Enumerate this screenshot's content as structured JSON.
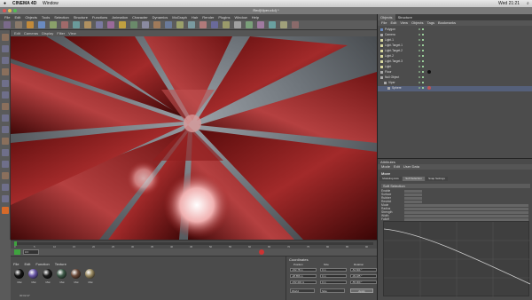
{
  "os": {
    "apple": "",
    "app": "CINEMA 4D",
    "window_menu": "Window",
    "clock": "Wed 21:21"
  },
  "title": "Red(Viper.c4d) *",
  "menubar": [
    "File",
    "Edit",
    "Objects",
    "Tools",
    "Selection",
    "Structure",
    "Functions",
    "Animation",
    "Character",
    "Dynamics",
    "MoGraph",
    "Hair",
    "Render",
    "Plugins",
    "Window",
    "Help"
  ],
  "viewport_menu": [
    "Edit",
    "Cameras",
    "Display",
    "Filter",
    "View"
  ],
  "toolbar": {
    "icon_count": 26
  },
  "left_tools": {
    "icon_count": 16
  },
  "timeline": {
    "ticks": [
      "0",
      "5",
      "10",
      "15",
      "20",
      "25",
      "30",
      "35",
      "40",
      "45",
      "50",
      "55",
      "60",
      "65",
      "70",
      "75",
      "80",
      "85",
      "90"
    ],
    "frame_field": "0 F"
  },
  "materials": {
    "menu": [
      "File",
      "Edit",
      "Function",
      "Texture"
    ],
    "items": [
      {
        "label": "Mat",
        "color": "#141414"
      },
      {
        "label": "Mat",
        "color": "#6a58a8"
      },
      {
        "label": "Mat",
        "color": "#1c1c1c"
      },
      {
        "label": "Mat",
        "color": "#3f5b4a"
      },
      {
        "label": "Mat",
        "color": "#6a4a3a"
      },
      {
        "label": "Mat",
        "color": "#9a8a62"
      }
    ],
    "status": "00:02:47"
  },
  "coordinates": {
    "header": "Coordinates",
    "columns": [
      "Position",
      "Size",
      "Rotation"
    ],
    "rows": [
      {
        "pos": "-152.78 m",
        "size": "0 m",
        "rot": "-54.604 °"
      },
      {
        "pos": "-28.856 m",
        "size": "0 m",
        "rot": "-39.185 °"
      },
      {
        "pos": "-152.432 m",
        "size": "0 m",
        "rot": "-55.000 °"
      }
    ],
    "mode": "World",
    "size_mode": "Size",
    "apply": "Apply"
  },
  "objects": {
    "tabs": [
      "Objects",
      "Structure"
    ],
    "menu": [
      "File",
      "Edit",
      "View",
      "Objects",
      "Tags",
      "Bookmarks"
    ],
    "list": [
      "Polygon",
      "Camera",
      "Light.1",
      "Light.Target.1",
      "Light.Target.2",
      "Light.2",
      "Light.Target.3",
      "Light",
      "Floor",
      "Null Object",
      "Viper",
      "Sphere"
    ]
  },
  "attributes": {
    "header": "Attributes",
    "menu": [
      "Mode",
      "Edit",
      "User Data"
    ],
    "tool": "Move",
    "tabs": [
      "Modeling Axis",
      "Soft Selection",
      "Snap Settings"
    ],
    "section": "Soft Selection",
    "rows": [
      "Enable",
      "Surface",
      "Rubber",
      "Restrict",
      "Mode",
      "Radius",
      "Strength",
      "Width",
      "Falloff"
    ]
  },
  "colors": {
    "accent": "#6a9ad0",
    "gem": "#8b1a1a",
    "play": "#3fa33f"
  }
}
